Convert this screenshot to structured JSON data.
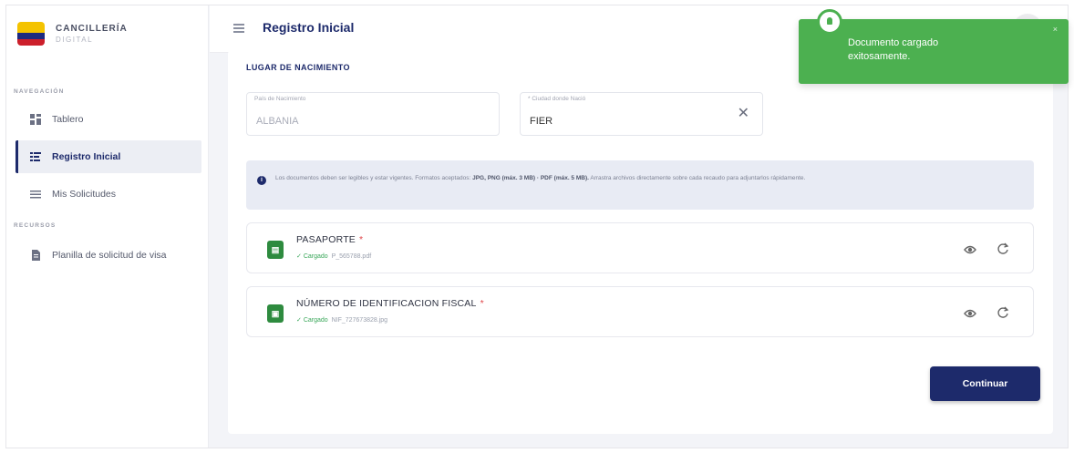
{
  "brand": {
    "title": "CANCILLERÍA",
    "subtitle": "DIGITAL"
  },
  "sidebar": {
    "nav_section": "NAVEGACIÓN",
    "nav_items": [
      {
        "label": "Tablero",
        "icon": "dashboard-icon"
      },
      {
        "label": "Registro Inicial",
        "icon": "register-icon",
        "active": true
      },
      {
        "label": "Mis Solicitudes",
        "icon": "list-icon"
      }
    ],
    "resources_section": "RECURSOS",
    "resource_items": [
      {
        "label": "Planilla de solicitud de visa",
        "icon": "document-icon"
      }
    ]
  },
  "header": {
    "title": "Registro Inicial"
  },
  "form": {
    "section_title": "LUGAR DE NACIMIENTO",
    "country": {
      "label": "País de Nacimiento",
      "value": "ALBANIA"
    },
    "city": {
      "label": "* Ciudad donde Nació",
      "value": "FIER"
    }
  },
  "info": {
    "text_before": "Los documentos deben ser legibles y estar vigentes. Formatos aceptados: ",
    "formats": "JPG, PNG (máx. 3 MB) · PDF (máx. 5 MB).",
    "text_after": " Arrastra archivos directamente sobre cada recaudo para adjuntarlos rápidamente."
  },
  "documents": [
    {
      "name": "PASAPORTE",
      "required_mark": "*",
      "status": "Cargado",
      "filename": "P_565788.pdf",
      "icon": "pdf-file-icon"
    },
    {
      "name": "NÚMERO DE IDENTIFICACION FISCAL",
      "required_mark": "*",
      "status": "Cargado",
      "filename": "NIF_727673828.jpg",
      "icon": "image-file-icon"
    }
  ],
  "actions": {
    "continue_label": "Continuar"
  },
  "toast": {
    "message": "Documento cargado exitosamente.",
    "close": "×"
  },
  "colors": {
    "primary": "#1d2a6b",
    "success": "#4cb050",
    "required": "#e0474b"
  }
}
